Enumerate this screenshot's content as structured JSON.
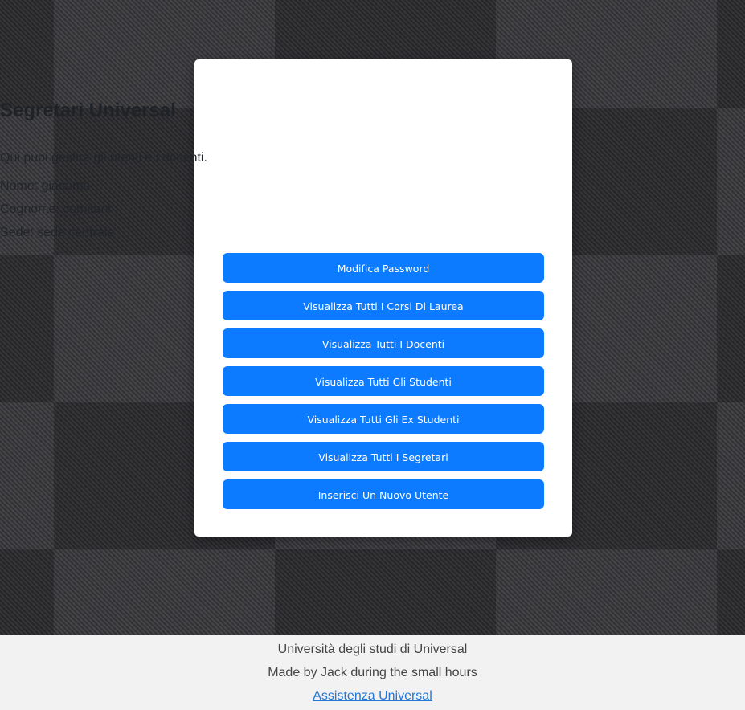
{
  "card": {
    "title": "Segretari Universal",
    "intro": "Qui puoi gestire gli utenti e i docenti.",
    "nome": "Nome: giacomo",
    "cognome": "Cognome: comitani",
    "sede": "Sede: sede centrale"
  },
  "buttons": [
    {
      "label": "Modifica Password"
    },
    {
      "label": "Visualizza Tutti I Corsi Di Laurea"
    },
    {
      "label": "Visualizza Tutti I Docenti"
    },
    {
      "label": "Visualizza Tutti Gli Studenti"
    },
    {
      "label": "Visualizza Tutti Gli Ex Studenti"
    },
    {
      "label": "Visualizza Tutti I Segretari"
    },
    {
      "label": "Inserisci Un Nuovo Utente"
    }
  ],
  "footer": {
    "university": "Università degli studi di Universal",
    "credits": "Made by Jack during the small hours",
    "support_link": "Assistenza Universal"
  },
  "colors": {
    "button": "#0d7bff",
    "link": "#2478d6",
    "background": "#3a3a3e"
  }
}
